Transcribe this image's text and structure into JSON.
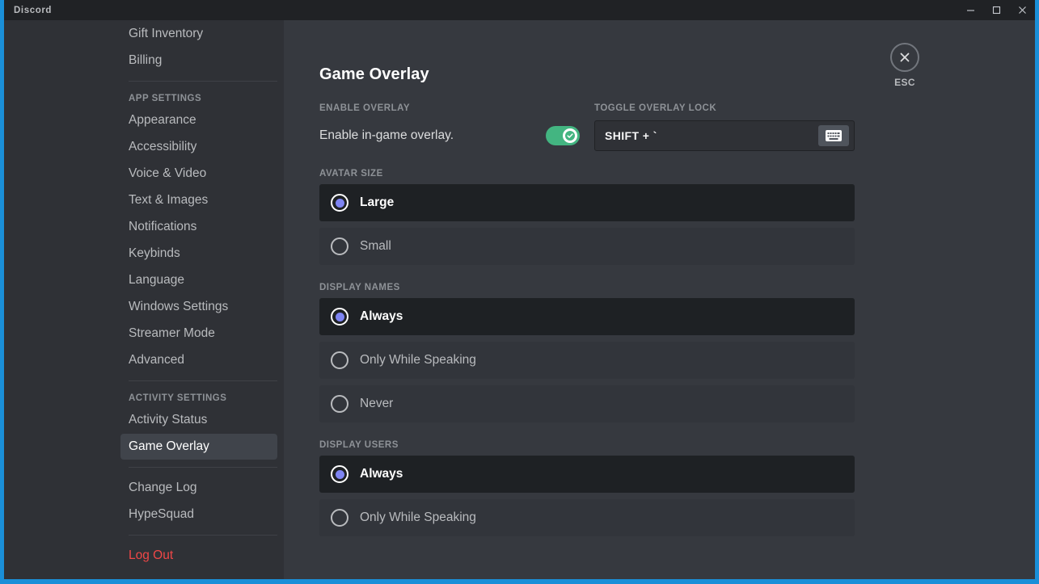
{
  "window": {
    "title": "Discord",
    "controls": [
      {
        "name": "minimize",
        "glyph": "minimize-icon"
      },
      {
        "name": "maximize",
        "glyph": "maximize-icon"
      },
      {
        "name": "close",
        "glyph": "close-icon"
      }
    ]
  },
  "sidebar": {
    "items": [
      {
        "type": "item",
        "label": "Gift Inventory",
        "active": false
      },
      {
        "type": "item",
        "label": "Billing",
        "active": false
      },
      {
        "type": "sep"
      },
      {
        "type": "header",
        "label": "App Settings"
      },
      {
        "type": "item",
        "label": "Appearance",
        "active": false
      },
      {
        "type": "item",
        "label": "Accessibility",
        "active": false
      },
      {
        "type": "item",
        "label": "Voice & Video",
        "active": false
      },
      {
        "type": "item",
        "label": "Text & Images",
        "active": false
      },
      {
        "type": "item",
        "label": "Notifications",
        "active": false
      },
      {
        "type": "item",
        "label": "Keybinds",
        "active": false
      },
      {
        "type": "item",
        "label": "Language",
        "active": false
      },
      {
        "type": "item",
        "label": "Windows Settings",
        "active": false
      },
      {
        "type": "item",
        "label": "Streamer Mode",
        "active": false
      },
      {
        "type": "item",
        "label": "Advanced",
        "active": false
      },
      {
        "type": "sep"
      },
      {
        "type": "header",
        "label": "Activity Settings"
      },
      {
        "type": "item",
        "label": "Activity Status",
        "active": false
      },
      {
        "type": "item",
        "label": "Game Overlay",
        "active": true
      },
      {
        "type": "sep"
      },
      {
        "type": "item",
        "label": "Change Log",
        "active": false
      },
      {
        "type": "item",
        "label": "HypeSquad",
        "active": false
      },
      {
        "type": "sep"
      },
      {
        "type": "item",
        "label": "Log Out",
        "active": false,
        "danger": true
      }
    ]
  },
  "main": {
    "title": "Game Overlay",
    "enable_overlay": {
      "section_label": "Enable Overlay",
      "row_label": "Enable in-game overlay.",
      "toggle_on": true,
      "toggle_color": "#43b581"
    },
    "toggle_overlay_lock": {
      "section_label": "Toggle Overlay Lock",
      "value": "SHIFT + `",
      "button_icon": "keyboard-icon"
    },
    "esc": {
      "label": "ESC",
      "icon": "close-icon"
    },
    "groups": [
      {
        "label": "Avatar Size",
        "options": [
          {
            "label": "Large",
            "selected": true
          },
          {
            "label": "Small",
            "selected": false
          }
        ]
      },
      {
        "label": "Display Names",
        "options": [
          {
            "label": "Always",
            "selected": true
          },
          {
            "label": "Only While Speaking",
            "selected": false
          },
          {
            "label": "Never",
            "selected": false
          }
        ]
      },
      {
        "label": "Display Users",
        "options": [
          {
            "label": "Always",
            "selected": true
          },
          {
            "label": "Only While Speaking",
            "selected": false
          }
        ]
      }
    ]
  },
  "colors": {
    "titlebar": "#202225",
    "sidebar": "#2f3136",
    "content": "#36393f",
    "row": "#32353b",
    "row_selected": "#1e2124",
    "accent_radio": "#7e84f2",
    "toggle_on": "#43b581",
    "danger": "#f04747",
    "window_border": "#1a8fd8"
  }
}
